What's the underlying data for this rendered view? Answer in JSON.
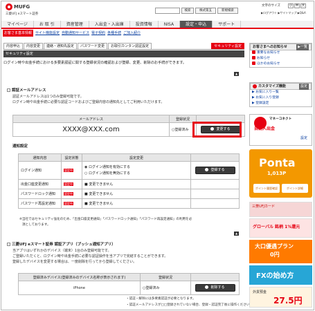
{
  "header": {
    "brand": "MUFG",
    "brand_sub": "三菱UFJ eスマート証券",
    "search_btn": "検索",
    "stock_btn": "株式第五",
    "news_btn": "新規検索",
    "font_size_label": "文字のサイズ",
    "font_small": "小",
    "font_mid": "中",
    "font_large": "大",
    "top_links": "▶ログアウト ▶サイトマップ ▶Q&A"
  },
  "nav": [
    "マイページ",
    "お 取 引",
    "資産管理",
    "入出金・入出庫",
    "投資情報",
    "NISA",
    "設定・申込",
    "サポート"
  ],
  "subnav": [
    "お客さま基本情報",
    "サイト機能設定",
    "自動通知サービス",
    "電子契約",
    "各種手続",
    "ご加入紹介"
  ],
  "tabs": [
    "内容申込",
    "内容変更",
    "連絡・通知先設定",
    "パスワード変更",
    "お取引カンタン認証設定",
    "セキュリティ設定"
  ],
  "page_heading": "セキュリティ設定",
  "intro": "ログイン時や出金手続における多要素認証に関する登録状況の確認および登録、変更、削除のお手続ができます。",
  "toggle_label": "▲",
  "auth_email": {
    "title": "認証メールアドレス",
    "desc1": "認証メールアドレスは1つのみ登録可能です。",
    "desc2": "ログイン時や出金手続に必要な認証コードおよびご登録内容の通知先としてご利用いただけます。",
    "col_address": "メールアドレス",
    "col_status": "登録状況",
    "address": "XXXX@XXX.com",
    "status": "○登録済み",
    "change_btn": "変更する"
  },
  "notify": {
    "title": "通知設定",
    "col_content": "通知内容",
    "col_state": "設定状態",
    "col_change": "設定変更",
    "rows": [
      {
        "label": "ログイン通知",
        "state": "設定中",
        "opt1": "ログイン通知を有効にする",
        "opt2": "ログイン通知を無効にする"
      },
      {
        "label": "出金口座変更通知",
        "state": "設定中",
        "opt1": "変更できません"
      },
      {
        "label": "パスワードロック通知",
        "state": "設定中",
        "opt1": "変更できません"
      },
      {
        "label": "パスワード再設定通知",
        "state": "設定中",
        "opt1": "変更できません"
      }
    ],
    "change_btn": "登録する",
    "note1": "※当社ではセキュリティ強化のため、「出金口座変更通知」「パスワードロック通知」「パスワード再設定通知」の利用を必",
    "note2": "須としております。"
  },
  "app_auth": {
    "title": "三菱UFJ eスマート証券 認証アプリ（プッシュ通知アプリ）",
    "desc1": "当アプリはいずれかのデバイス（端末）1台のみ登録可能です。",
    "desc2": "ご登録いただくと、ログイン時や出金手続に必要な認証操作を当アプリで完結することができます。",
    "desc3": "登録したデバイスを変更する場合は、一度削除を行ってから登録してください。",
    "col_device": "登録済みデバイス(登録済みのデバイス名称が表示されます)",
    "col_status": "登録状況",
    "device": "iPhone",
    "status": "○登録済み",
    "btn": "削除する",
    "note1": "・認証・解除には多要素認証が必要となります。",
    "note2": "・認証メールアドレスが□□登録されていない場合、登録・認証完了後に操作ください。"
  },
  "sidebar": {
    "notice_title": "お客さまへのお知らせ",
    "notice_more": "▶一覧",
    "links": [
      "重要なお知らせ",
      "お知らせ",
      "ほかのお知らせ"
    ],
    "customize_title": "カスタマイズ機能",
    "customize_btn": "設定",
    "customize_links": [
      "お気に入り一覧",
      "お気に入り登録",
      "登録設定"
    ],
    "cash_title": "マネーコネクト",
    "cash_label": "自動入出金",
    "cash_btn": "設定",
    "ponta_brand": "Ponta",
    "ponta_points": "1,013P",
    "ponta_link1": "ポイント履歴確認",
    "ponta_link2": "ポイント詳細",
    "banner1": "三菱UFJカード",
    "banner2": "グローバル 銘柄 1%還元",
    "banner3": "大口優遇プラン",
    "banner3_sub": "0円",
    "banner4": "FXの始め方",
    "banner5": "外貨預金",
    "banner5_num": "27.5円"
  },
  "colors": {
    "brand_red": "#e60012",
    "dark_btn": "#3a3a3a",
    "ponta_orange": "#f39800"
  }
}
